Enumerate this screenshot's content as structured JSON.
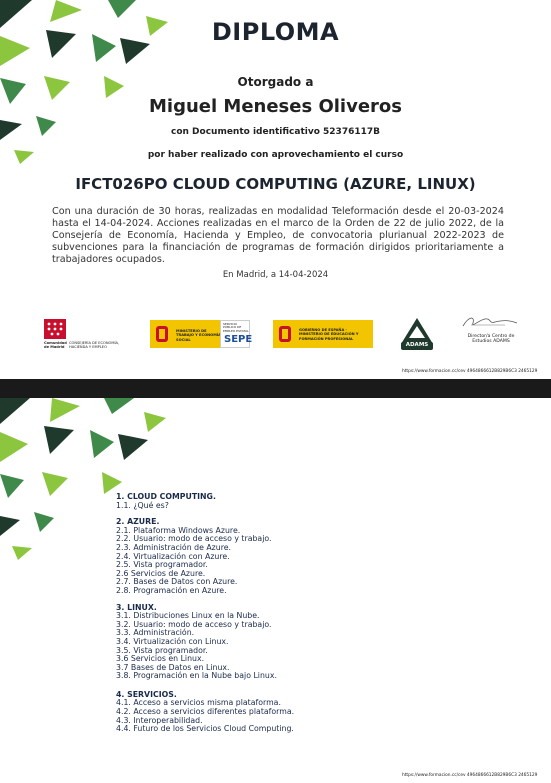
{
  "diploma": {
    "title": "DIPLOMA",
    "awarded_to": "Otorgado a",
    "recipient": "Miguel Meneses Oliveros",
    "document_id": "con Documento identificativo 52376117B",
    "reason": "por haber realizado con aprovechamiento el curso",
    "course": "IFCT026PO CLOUD COMPUTING (AZURE, LINUX)",
    "body": "Con una duración de 30 horas, realizadas en modalidad Teleformación desde el 20-03-2024 hasta el 14-04-2024. Acciones realizadas en el marco de la Orden de 22 de julio 2022, de la Consejería de Economía, Hacienda y Empleo, de convocatoria plurianual 2022-2023 de subvenciones para la financiación de programas de formación dirigidos prioritariamente a trabajadores ocupados.",
    "place_date": "En Madrid, a 14-04-2024"
  },
  "logos": {
    "madrid_name": "Comunidad de Madrid",
    "madrid_dept": "CONSEJERÍA DE ECONOMÍA, HACIENDA Y EMPLEO",
    "ministry_labor": "MINISTERIO DE TRABAJO Y ECONOMÍA SOCIAL",
    "sepe_label": "SERVICIO PÚBLICO DE EMPLEO ESTATAL",
    "sepe": "SEPE",
    "ministry_education": "GOBIERNO DE ESPAÑA · MINISTERIO DE EDUCACIÓN Y FORMACIÓN PROFESIONAL",
    "adams": "ADAMS",
    "signature_label": "Director/a Centro de Estudios ADAMS"
  },
  "verification": {
    "line1": "https://www.formacion.cc/cev   4964866612B829B6C3   2465129",
    "line2": "https://www.formacion.cc/cev   4964866612B829B6C3   2465129"
  },
  "syllabus": [
    {
      "title": "1. CLOUD COMPUTING.",
      "items": [
        "1.1. ¿Qué es?"
      ]
    },
    {
      "title": "2. AZURE.",
      "items": [
        "2.1. Plataforma Windows Azure.",
        "2.2. Usuario: modo de acceso y trabajo.",
        "2.3. Administración de Azure.",
        "2.4. Virtualización con Azure.",
        "2.5. Vista programador.",
        "2.6 Servicios de Azure.",
        "2.7. Bases de Datos con Azure.",
        "2.8. Programación en Azure."
      ]
    },
    {
      "title": "3. LINUX.",
      "items": [
        "3.1. Distribuciones Linux en la Nube.",
        "3.2. Usuario: modo de acceso y trabajo.",
        "3.3. Administración.",
        "3.4. Virtualización con Linux.",
        "3.5. Vista programador.",
        "3.6 Servicios en Linux.",
        "3.7 Bases de Datos en Linux.",
        "3.8. Programación en la Nube bajo Linux."
      ]
    },
    {
      "title": "4. SERVICIOS.",
      "items": [
        "4.1. Acceso a servicios misma plataforma.",
        "4.2. Acceso a servicios diferentes plataforma.",
        "4.3. Interoperabilidad.",
        "4.4. Futuro de los Servicios Cloud Computing."
      ]
    }
  ],
  "colors": {
    "dark_green": "#1f3a2c",
    "green": "#3f8a4a",
    "light_green": "#8cc63f",
    "red": "#c8102e",
    "yellow": "#f2c500"
  }
}
